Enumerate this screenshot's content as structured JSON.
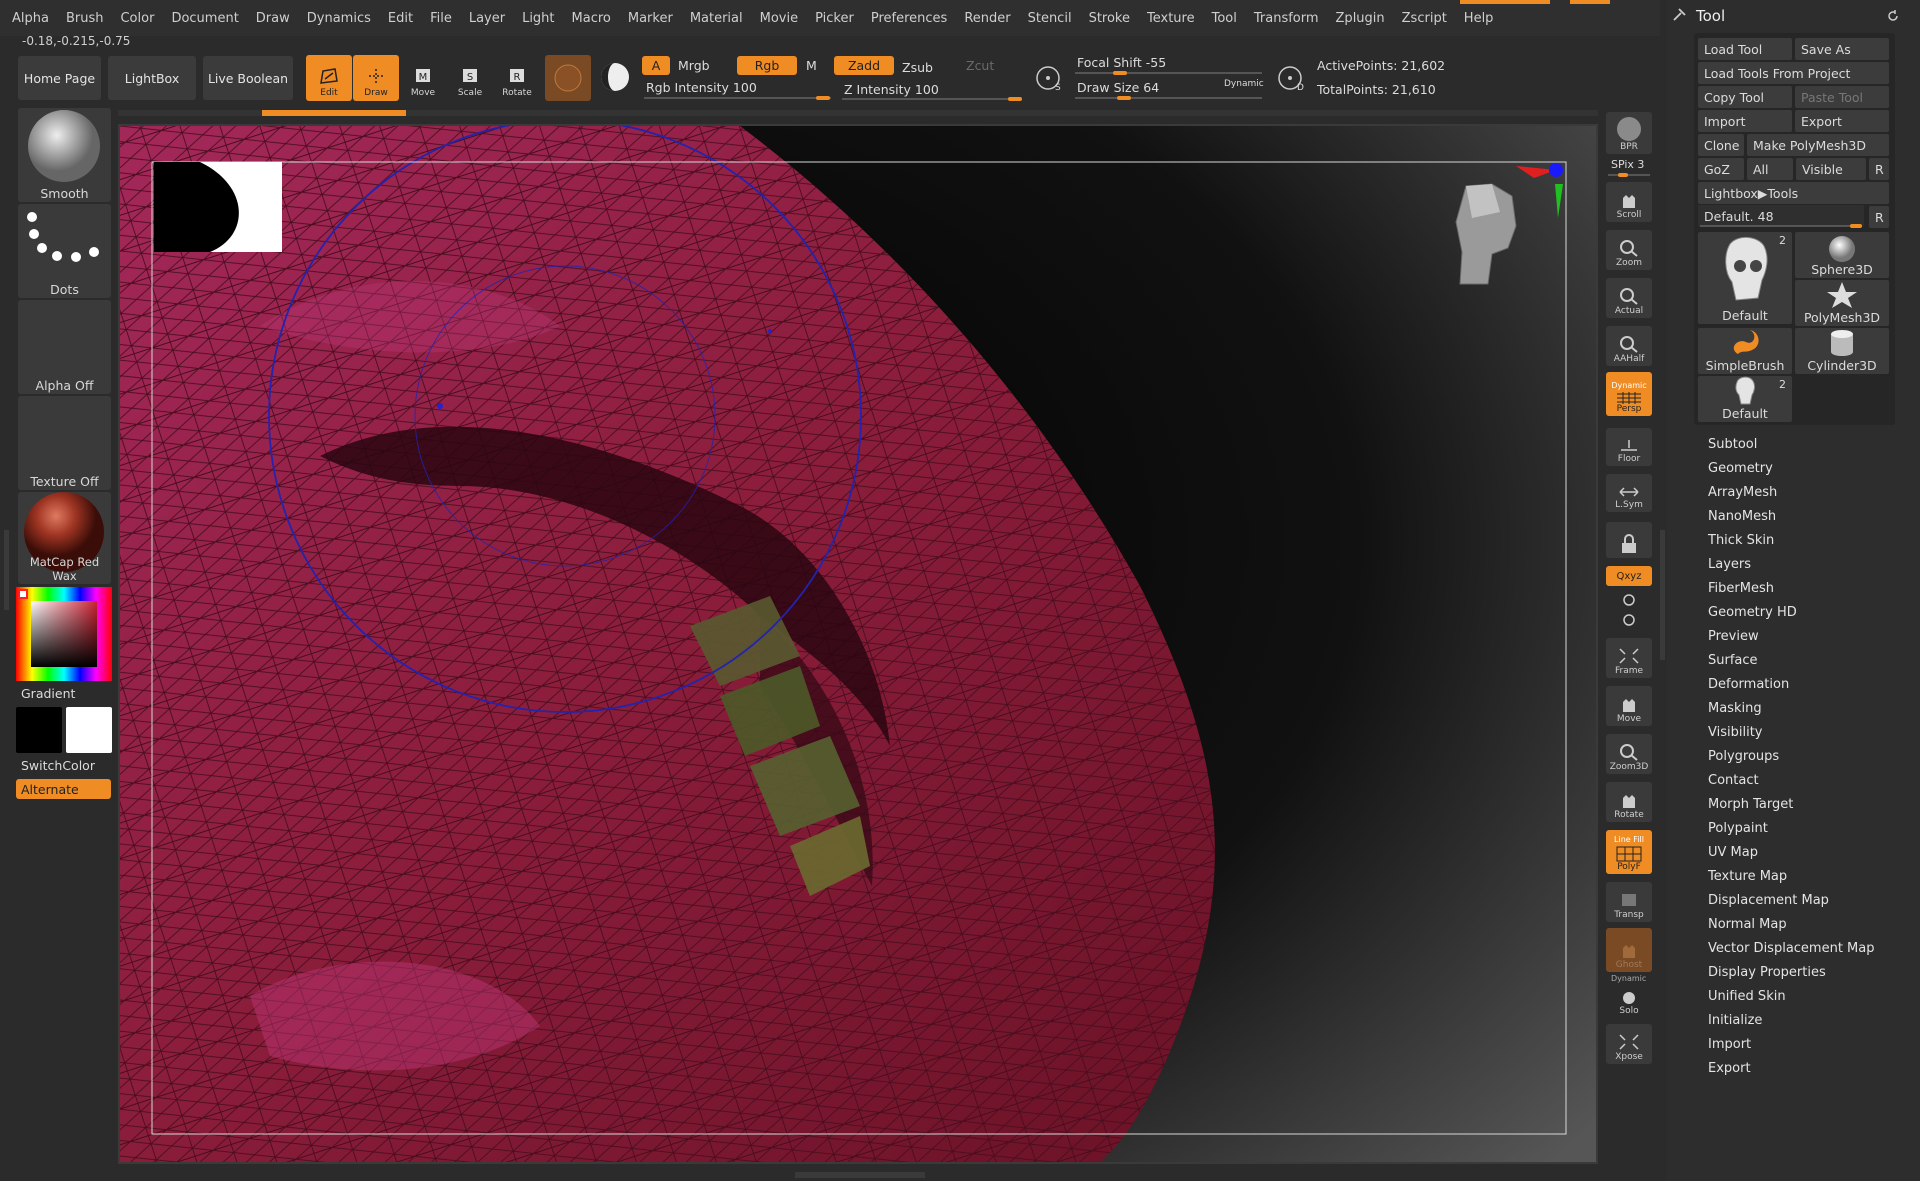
{
  "menu": [
    "Alpha",
    "Brush",
    "Color",
    "Document",
    "Draw",
    "Dynamics",
    "Edit",
    "File",
    "Layer",
    "Light",
    "Macro",
    "Marker",
    "Material",
    "Movie",
    "Picker",
    "Preferences",
    "Render",
    "Stencil",
    "Stroke",
    "Texture",
    "Tool",
    "Transform",
    "Zplugin",
    "Zscript",
    "Help"
  ],
  "coords": "-0.18,-0.215,-0.75",
  "toolbar": {
    "home": "Home Page",
    "lightbox": "LightBox",
    "live_boolean": "Live Boolean",
    "edit": "Edit",
    "draw": "Draw",
    "move": "Move",
    "scale": "Scale",
    "rotate": "Rotate",
    "a": "A",
    "mrgb": "Mrgb",
    "rgb": "Rgb",
    "m": "M",
    "zadd": "Zadd",
    "zsub": "Zsub",
    "zcut": "Zcut",
    "rgb_intensity": "Rgb Intensity 100",
    "z_intensity": "Z Intensity 100",
    "focal_shift": "Focal Shift -55",
    "draw_size": "Draw Size 64",
    "dynamic": "Dynamic",
    "s": "S",
    "d": "D",
    "active_points": "ActivePoints: 21,602",
    "total_points": "TotalPoints: 21,610"
  },
  "left": {
    "smooth": "Smooth",
    "dots": "Dots",
    "alpha": "Alpha Off",
    "texture": "Texture Off",
    "matcap": "MatCap Red Wax",
    "gradient": "Gradient",
    "switch": "SwitchColor",
    "alternate": "Alternate"
  },
  "shelf": {
    "bpr": "BPR",
    "spix": "SPix 3",
    "scroll": "Scroll",
    "zoom": "Zoom",
    "actual": "Actual",
    "aahalf": "AAHalf",
    "dynamic": "Dynamic",
    "persp": "Persp",
    "floor": "Floor",
    "lsym": "L.Sym",
    "xyz": "Qxyz",
    "frame": "Frame",
    "move": "Move",
    "zoom3d": "Zoom3D",
    "rotate": "Rotate",
    "linefill": "Line Fill",
    "polyf": "PolyF",
    "transp": "Transp",
    "ghost": "Ghost",
    "dynamic2": "Dynamic",
    "solo": "Solo",
    "xpose": "Xpose"
  },
  "tool": {
    "title": "Tool",
    "load_tool": "Load Tool",
    "save_as": "Save As",
    "load_from_project": "Load Tools From Project",
    "copy_tool": "Copy Tool",
    "paste_tool": "Paste Tool",
    "import": "Import",
    "export": "Export",
    "clone": "Clone",
    "make_polymesh": "Make PolyMesh3D",
    "goz": "GoZ",
    "all": "All",
    "visible": "Visible",
    "r": "R",
    "lightbox_tools": "Lightbox▶Tools",
    "default_value": "Default. 48",
    "r2": "R",
    "tiles": {
      "default_count": "2",
      "default": "Default",
      "sphere": "Sphere3D",
      "polymesh": "PolyMesh3D",
      "simplebrush": "SimpleBrush",
      "cylinder": "Cylinder3D",
      "default2_count": "2",
      "default2": "Default"
    },
    "sections": [
      "Subtool",
      "Geometry",
      "ArrayMesh",
      "NanoMesh",
      "Thick Skin",
      "Layers",
      "FiberMesh",
      "Geometry HD",
      "Preview",
      "Surface",
      "Deformation",
      "Masking",
      "Visibility",
      "Polygroups",
      "Contact",
      "Morph Target",
      "Polypaint",
      "UV Map",
      "Texture Map",
      "Displacement Map",
      "Normal Map",
      "Vector Displacement Map",
      "Display Properties",
      "Unified Skin",
      "Initialize",
      "Import",
      "Export"
    ]
  },
  "colors": {
    "accent": "#f08c24",
    "mesh": "#8a1d3a",
    "canvas": "#000000"
  }
}
